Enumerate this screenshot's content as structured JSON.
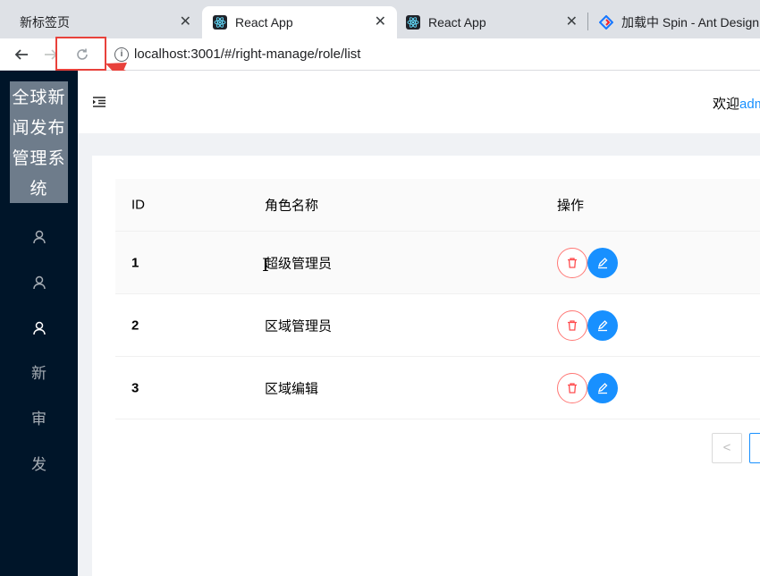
{
  "browser": {
    "tabs": [
      {
        "title": "新标签页",
        "close": "✕"
      },
      {
        "title": "React App",
        "close": "✕"
      },
      {
        "title": "React App",
        "close": "✕"
      },
      {
        "title": "加载中 Spin - Ant Design"
      }
    ],
    "url": "localhost:3001/#/right-manage/role/list",
    "back_icon": "arrow-left-icon",
    "forward_icon": "arrow-right-icon",
    "reload_icon": "reload-icon"
  },
  "sidebar": {
    "logo": "全球新闻发布管理系统",
    "items": [
      {
        "icon": "user-icon"
      },
      {
        "icon": "user-icon"
      },
      {
        "icon": "user-icon",
        "selected": true
      },
      {
        "label": "新"
      },
      {
        "label": "审"
      },
      {
        "label": "发"
      }
    ]
  },
  "header": {
    "fold_icon": "menu-unfold-icon",
    "welcome": "欢迎",
    "username": "adm"
  },
  "table": {
    "columns": [
      "ID",
      "角色名称",
      "操作"
    ],
    "rows": [
      {
        "id": "1",
        "name": "超级管理员"
      },
      {
        "id": "2",
        "name": "区域管理员"
      },
      {
        "id": "3",
        "name": "区域编辑"
      }
    ],
    "delete_icon": "delete-icon",
    "edit_icon": "edit-icon"
  },
  "pagination": {
    "prev": "<"
  },
  "colors": {
    "sidebar_bg": "#001529",
    "primary": "#1890ff",
    "danger": "#ff4d4f",
    "annotation": "#e8413b"
  }
}
